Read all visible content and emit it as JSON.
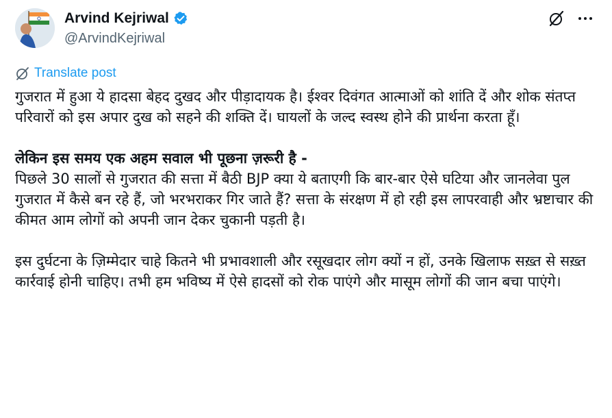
{
  "author": {
    "name": "Arvind Kejriwal",
    "handle": "@ArvindKejriwal",
    "verified": true
  },
  "icons": {
    "verified": "verified-badge-icon",
    "grok": "grok-icon",
    "more": "more-options-icon",
    "translate": "translate-icon"
  },
  "colors": {
    "accent": "#1d9bf0",
    "text_primary": "#0f1419",
    "text_secondary": "#536471"
  },
  "translate_label": "Translate post",
  "post": {
    "paragraph_1": "गुजरात में हुआ ये हादसा बेहद दुखद और पीड़ादायक है। ईश्वर दिवंगत आत्माओं को शांति दें और शोक संतप्त परिवारों को इस अपार दुख को सहने की शक्ति दें। घायलों के जल्द स्वस्थ होने की प्रार्थना करता हूँ।",
    "heading": "लेकिन इस समय एक अहम सवाल भी पूछना ज़रूरी है -",
    "paragraph_2": "पिछले 30 सालों से गुजरात की सत्ता में बैठी BJP क्या ये बताएगी कि बार-बार ऐसे घटिया और जानलेवा पुल गुजरात में कैसे बन रहे हैं, जो भरभराकर गिर जाते हैं? सत्ता के संरक्षण में हो रही इस लापरवाही और भ्रष्टाचार की कीमत आम लोगों को अपनी जान देकर चुकानी पड़ती है।",
    "paragraph_3": "इस दुर्घटना के ज़िम्मेदार चाहे कितने भी प्रभावशाली और रसूखदार लोग क्यों न हों, उनके खिलाफ सख़्त से सख़्त कार्रवाई होनी चाहिए। तभी हम भविष्य में ऐसे हादसों को रोक पाएंगे और मासूम लोगों की जान बचा पाएंगे।"
  }
}
